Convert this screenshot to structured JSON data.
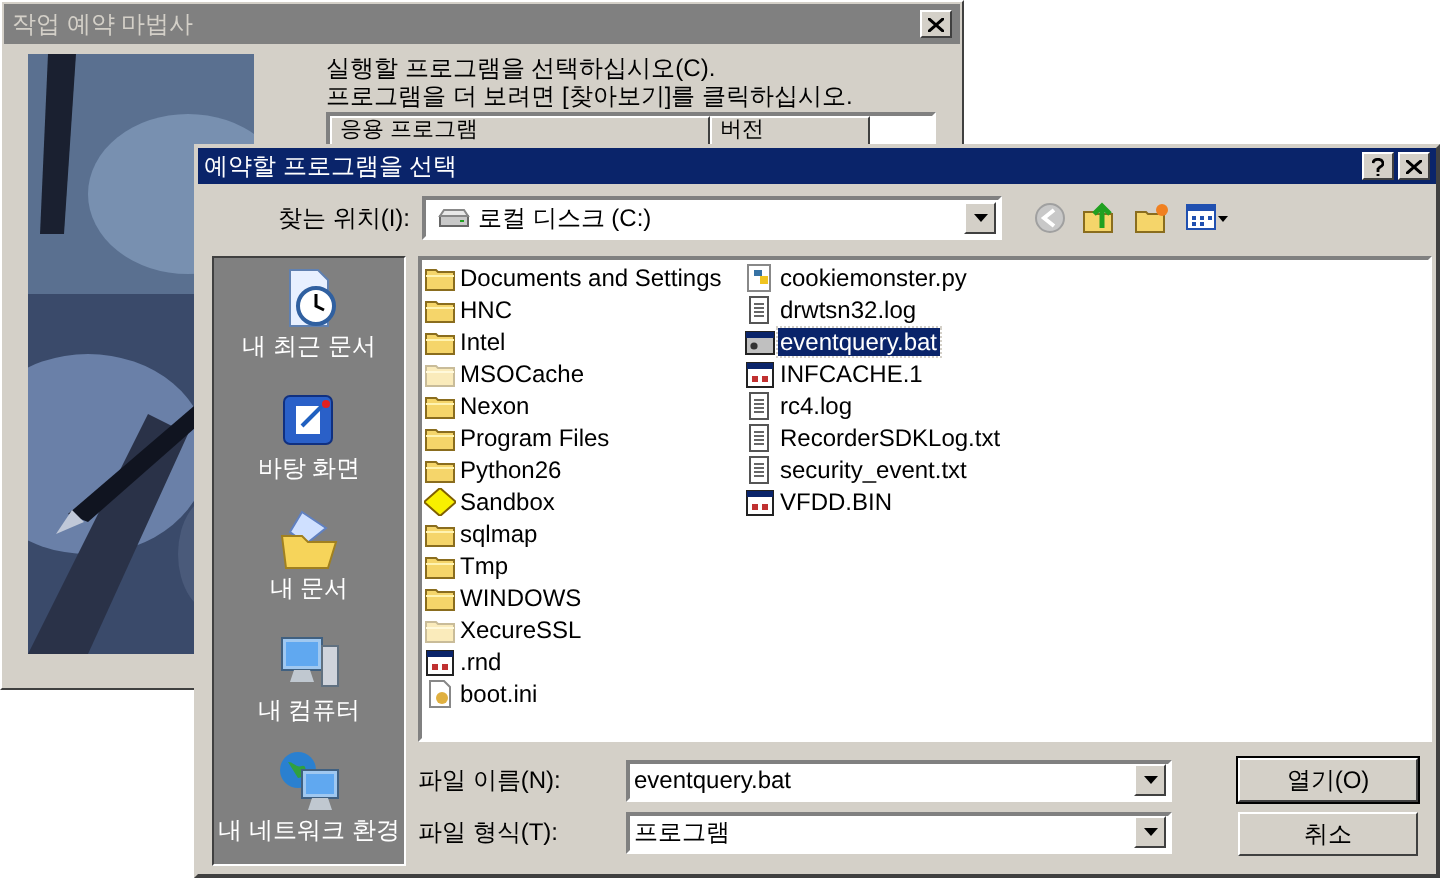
{
  "wizard": {
    "title": "작업 예약 마법사",
    "instruction_lines": [
      "실행할 프로그램을 선택하십시오(C).",
      "프로그램을 더 보려면 [찾아보기]를 클릭하십시오."
    ],
    "table_columns": [
      "응용 프로그램",
      "버전"
    ]
  },
  "dialog": {
    "title": "예약할 프로그램을 선택",
    "look_in": {
      "label": "찾는 위치(I):",
      "value": "로컬 디스크 (C:)"
    },
    "places": [
      {
        "kind": "recent",
        "label": "내 최근 문서"
      },
      {
        "kind": "desktop",
        "label": "바탕 화면"
      },
      {
        "kind": "documents",
        "label": "내 문서"
      },
      {
        "kind": "computer",
        "label": "내 컴퓨터"
      },
      {
        "kind": "network",
        "label": "내 네트워크 환경"
      }
    ],
    "file_columns": [
      [
        {
          "kind": "folder",
          "name": "Documents and Settings",
          "selected": false
        },
        {
          "kind": "folder",
          "name": "HNC",
          "selected": false
        },
        {
          "kind": "folder",
          "name": "Intel",
          "selected": false
        },
        {
          "kind": "folder-hidden",
          "name": "MSOCache",
          "selected": false
        },
        {
          "kind": "folder",
          "name": "Nexon",
          "selected": false
        },
        {
          "kind": "folder",
          "name": "Program Files",
          "selected": false
        },
        {
          "kind": "folder",
          "name": "Python26",
          "selected": false
        },
        {
          "kind": "sandbox",
          "name": "Sandbox",
          "selected": false
        },
        {
          "kind": "folder",
          "name": "sqlmap",
          "selected": false
        },
        {
          "kind": "folder",
          "name": "Tmp",
          "selected": false
        },
        {
          "kind": "folder",
          "name": "WINDOWS",
          "selected": false
        },
        {
          "kind": "folder-hidden",
          "name": "XecureSSL",
          "selected": false
        },
        {
          "kind": "system",
          "name": ".rnd",
          "selected": false
        },
        {
          "kind": "settings",
          "name": "boot.ini",
          "selected": false
        }
      ],
      [
        {
          "kind": "python",
          "name": "cookiemonster.py",
          "selected": false
        },
        {
          "kind": "text",
          "name": "drwtsn32.log",
          "selected": false
        },
        {
          "kind": "batch",
          "name": "eventquery.bat",
          "selected": true
        },
        {
          "kind": "system",
          "name": "INFCACHE.1",
          "selected": false
        },
        {
          "kind": "text",
          "name": "rc4.log",
          "selected": false
        },
        {
          "kind": "text",
          "name": "RecorderSDKLog.txt",
          "selected": false
        },
        {
          "kind": "text",
          "name": "security_event.txt",
          "selected": false
        },
        {
          "kind": "system",
          "name": "VFDD.BIN",
          "selected": false
        }
      ]
    ],
    "file_name": {
      "label": "파일 이름(N):",
      "value": "eventquery.bat"
    },
    "file_type": {
      "label": "파일 형식(T):",
      "value": "프로그램"
    },
    "buttons": [
      {
        "label": "열기(O)",
        "default": true
      },
      {
        "label": "취소",
        "default": false
      }
    ]
  }
}
